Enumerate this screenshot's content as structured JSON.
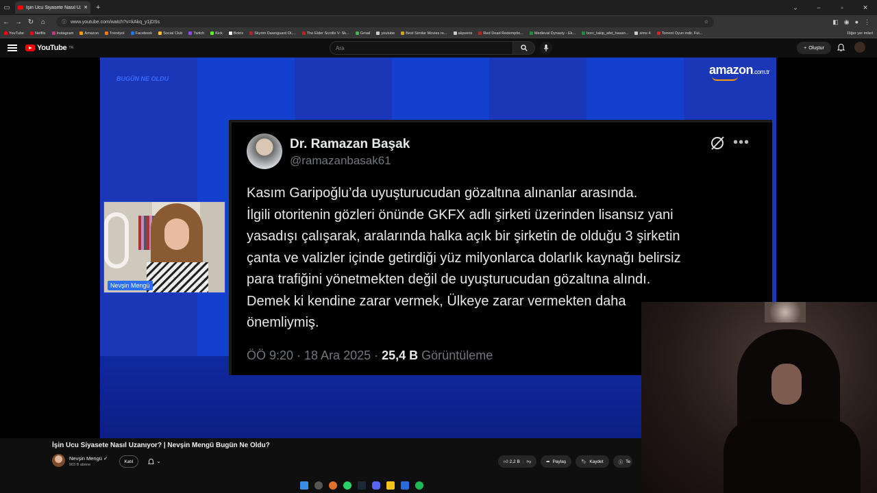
{
  "browser": {
    "tab_title": "İşin Ucu Siyasete Nasıl Uzan",
    "url": "www.youtube.com/watch?v=kAkq_y1jDSs",
    "bookmarks": [
      "YouTube",
      "Netflix",
      "Instagram",
      "Amazon",
      "Trendyol",
      "Facebook",
      "Social Club",
      "Twitch",
      "Kick",
      "Botrix",
      "Skyrim Dawnguard DL...",
      "The Elder Scrolls V: Sk...",
      "Gmail",
      "youtube",
      "Best Similar Movies re...",
      "akpveris",
      "Red Dead Redemptio...",
      "Medieval Dynasty - Ek...",
      "borc_takip_afet_hasan...",
      "sims 4",
      "Torrent Oyun indir, Ful..."
    ],
    "other_bookmarks": "Diğer yer imleri"
  },
  "youtube": {
    "logo": "YouTube",
    "region": "TR",
    "search_placeholder": "Ara",
    "create_label": "Oluştur"
  },
  "video_frame": {
    "brand_logo": "BUGÜN NE OLDU",
    "amazon_logo": "amazon",
    "amazon_tld": ".com.tr",
    "host_tag": "Nevşin Mengü",
    "tweet": {
      "name": "Dr. Ramazan Başak",
      "handle": "@ramazanbasak61",
      "lines": [
        "Kasım Garipoğlu’da uyuşturucudan gözaltına alınanlar arasında.",
        "İlgili otoritenin gözleri önünde GKFX adlı şirketi üzerinden lisansız yani",
        "yasadışı çalışarak, aralarında halka açık bir şirketin de olduğu 3 şirketin",
        "çanta ve valizler içinde getirdiği yüz milyonlarca dolarlık kaynağı belirsiz",
        "para trafiğini yönetmekten değil de uyuşturucudan gözaltına alındı.",
        "Demek ki kendine zarar vermek, Ülkeye zarar vermekten daha",
        "önemliymiş."
      ],
      "time": "ÖÖ 9:20 · 18 Ara 2025 · ",
      "views": "25,4 B",
      "views_label": " Görüntüleme"
    }
  },
  "video_info": {
    "title": "İşin Ucu Siyasete Nasıl Uzanıyor? | Nevşin Mengü Bugün Ne Oldu?",
    "channel": "Nevşin Mengü",
    "subscribers": "903 B abone",
    "join_label": "Katıl",
    "likes": "2,2 B",
    "share_label": "Paylaş",
    "save_label": "Kaydet",
    "thanks_label": "Te"
  },
  "colors": {
    "accent": "#ff0000",
    "video_bg": "#1a37b8",
    "tweet_bg": "#000000"
  }
}
